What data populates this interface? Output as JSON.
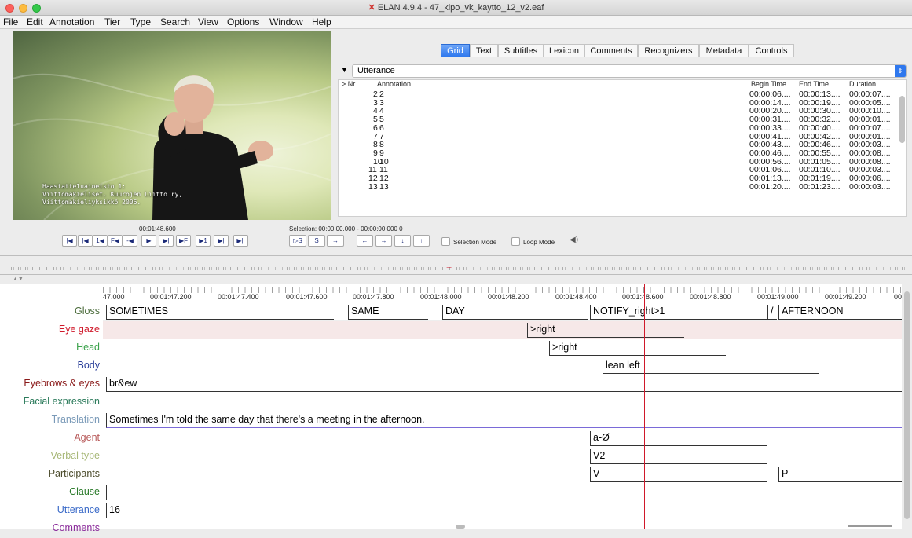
{
  "window": {
    "title": "ELAN 4.9.4 - 47_kipo_vk_kaytto_12_v2.eaf"
  },
  "menu": [
    "File",
    "Edit",
    "Annotation",
    "Tier",
    "Type",
    "Search",
    "View",
    "Options",
    "Window",
    "Help"
  ],
  "video": {
    "caption": [
      "Haastatteluaineisto 1:",
      "Viittomakieliset. Kuurojen Liitto ry,",
      "Viittomakieliyksikkö 2006."
    ]
  },
  "tabs": [
    "Grid",
    "Text",
    "Subtitles",
    "Lexicon",
    "Comments",
    "Recognizers",
    "Metadata",
    "Controls"
  ],
  "active_tab": "Grid",
  "grid": {
    "tier": "Utterance",
    "headers": {
      "nr": "> Nr",
      "annotation": "Annotation",
      "begin": "Begin Time",
      "end": "End Time",
      "duration": "Duration"
    },
    "rows": [
      {
        "nr": "2",
        "ann": "2",
        "begin": "00:00:06....",
        "end": "00:00:13....",
        "dur": "00:00:07...."
      },
      {
        "nr": "3",
        "ann": "3",
        "begin": "00:00:14....",
        "end": "00:00:19....",
        "dur": "00:00:05...."
      },
      {
        "nr": "4",
        "ann": "4",
        "begin": "00:00:20....",
        "end": "00:00:30....",
        "dur": "00:00:10...."
      },
      {
        "nr": "5",
        "ann": "5",
        "begin": "00:00:31....",
        "end": "00:00:32....",
        "dur": "00:00:01...."
      },
      {
        "nr": "6",
        "ann": "6",
        "begin": "00:00:33....",
        "end": "00:00:40....",
        "dur": "00:00:07...."
      },
      {
        "nr": "7",
        "ann": "7",
        "begin": "00:00:41....",
        "end": "00:00:42....",
        "dur": "00:00:01...."
      },
      {
        "nr": "8",
        "ann": "8",
        "begin": "00:00:43....",
        "end": "00:00:46....",
        "dur": "00:00:03...."
      },
      {
        "nr": "9",
        "ann": "9",
        "begin": "00:00:46....",
        "end": "00:00:55....",
        "dur": "00:00:08...."
      },
      {
        "nr": "10",
        "ann": "10",
        "begin": "00:00:56....",
        "end": "00:01:05....",
        "dur": "00:00:08...."
      },
      {
        "nr": "11",
        "ann": "11",
        "begin": "00:01:06....",
        "end": "00:01:10....",
        "dur": "00:00:03...."
      },
      {
        "nr": "12",
        "ann": "12",
        "begin": "00:01:13....",
        "end": "00:01:19....",
        "dur": "00:00:06...."
      },
      {
        "nr": "13",
        "ann": "13",
        "begin": "00:01:20....",
        "end": "00:01:23....",
        "dur": "00:00:03...."
      }
    ]
  },
  "player": {
    "current_time": "00:01:48.600",
    "selection": "Selection: 00:00:00.000 - 00:00:00.000  0",
    "buttons": [
      "|◀",
      "|◀",
      "1◀",
      "F◀",
      "-◀",
      "▶",
      "▶|",
      "▶F",
      "▶1",
      "▶|",
      "▶||"
    ],
    "sel_buttons": [
      "▷S",
      "S",
      "→"
    ],
    "nav_buttons": [
      "←",
      "→",
      "↓",
      "↑"
    ],
    "selection_mode": "Selection Mode",
    "loop_mode": "Loop Mode"
  },
  "timeline": {
    "ticks": [
      "47.000",
      "00:01:47.200",
      "00:01:47.400",
      "00:01:47.600",
      "00:01:47.800",
      "00:01:48.000",
      "00:01:48.200",
      "00:01:48.400",
      "00:01:48.600",
      "00:01:48.800",
      "00:01:49.000",
      "00:01:49.200",
      "00"
    ],
    "tiers": [
      {
        "name": "Gloss",
        "color": "#4a6b3a",
        "annotations": [
          "SOMETIMES",
          "SAME",
          "DAY",
          "NOTIFY_right>1",
          "/",
          "AFTERNOON"
        ]
      },
      {
        "name": "Eye gaze",
        "color": "#d0182a",
        "annotations": [
          ">right"
        ]
      },
      {
        "name": "Head",
        "color": "#3aa24a",
        "annotations": [
          ">right"
        ]
      },
      {
        "name": "Body",
        "color": "#2a3f9a",
        "annotations": [
          "lean left"
        ]
      },
      {
        "name": "Eyebrows & eyes",
        "color": "#8a1a1a",
        "annotations": [
          "br&ew"
        ]
      },
      {
        "name": "Facial expression",
        "color": "#2a7a5a",
        "annotations": []
      },
      {
        "name": "Translation",
        "color": "#7a9ab8",
        "annotations": [
          "Sometimes I'm told the same day that there's a meeting in the afternoon."
        ]
      },
      {
        "name": "Agent",
        "color": "#b85a5a",
        "annotations": [
          "a-Ø"
        ]
      },
      {
        "name": "Verbal type",
        "color": "#a8b878",
        "annotations": [
          "V2"
        ]
      },
      {
        "name": "Participants",
        "color": "#4a4a2a",
        "annotations": [
          "V",
          "P"
        ]
      },
      {
        "name": "Clause",
        "color": "#2a7a2a",
        "annotations": [
          ""
        ]
      },
      {
        "name": "Utterance",
        "color": "#3a6ac8",
        "annotations": [
          "16"
        ]
      },
      {
        "name": "Comments",
        "color": "#8a2a9a",
        "annotations": []
      }
    ]
  }
}
